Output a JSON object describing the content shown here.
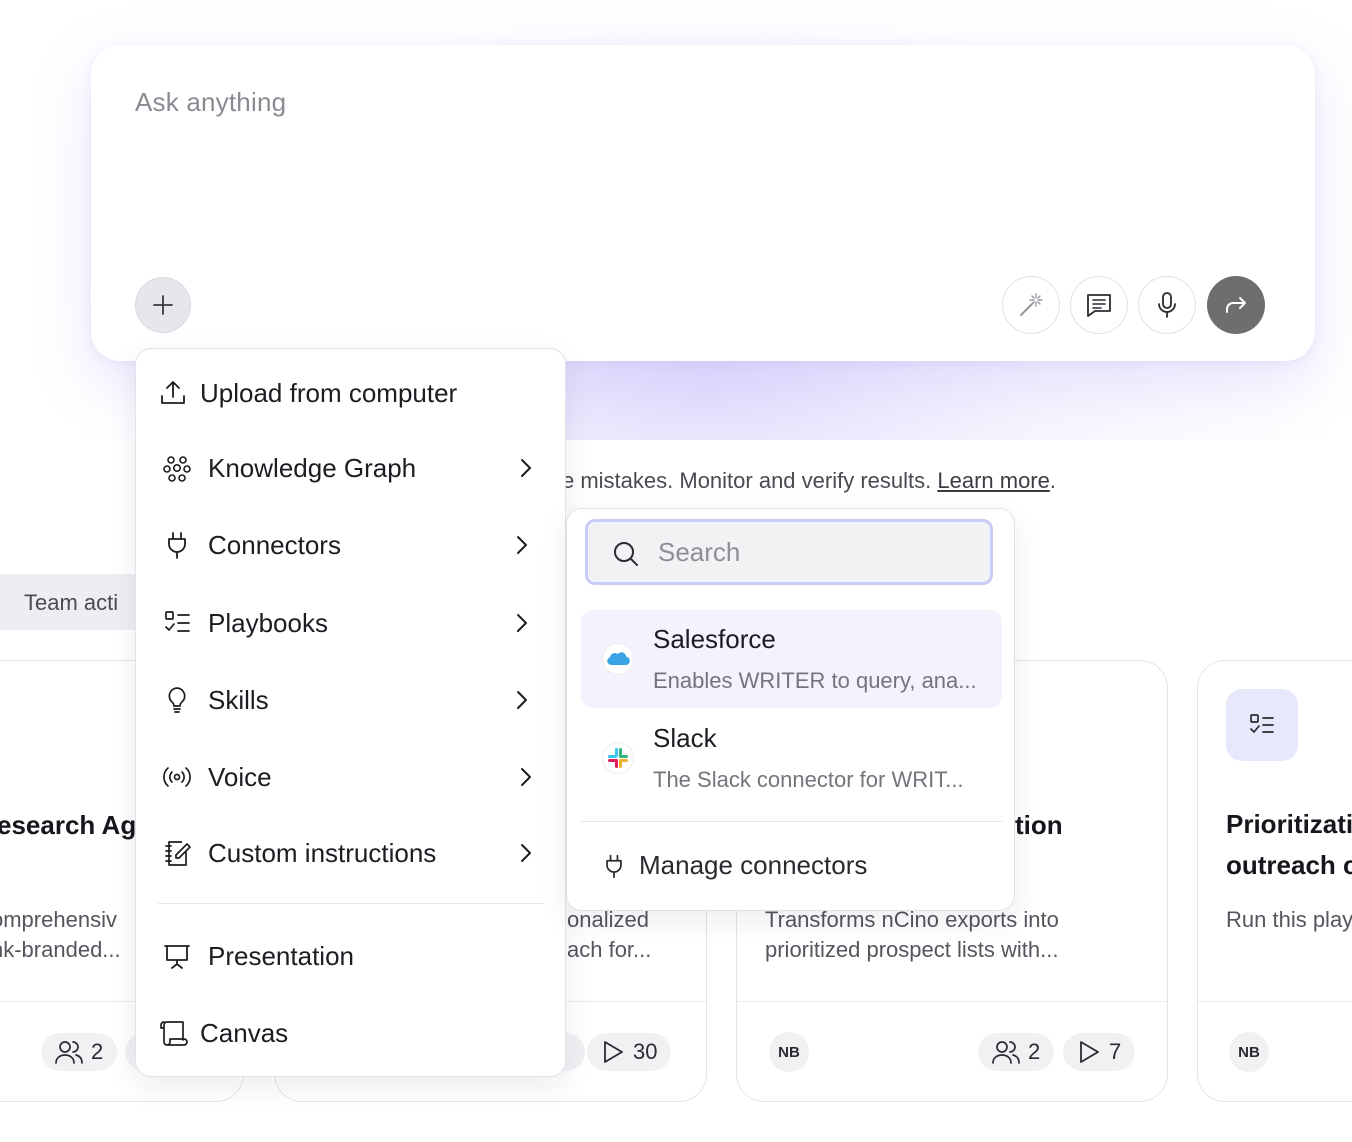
{
  "composer": {
    "placeholder": "Ask anything",
    "add_icon": "plus-icon",
    "tools": [
      {
        "name": "magic-wand-icon"
      },
      {
        "name": "message-square-icon"
      },
      {
        "name": "microphone-icon"
      }
    ],
    "send_icon": "forward-arrow-icon"
  },
  "disclaimer": {
    "text": "e mistakes. Monitor and verify results. ",
    "link": "Learn more",
    "suffix": "."
  },
  "tabs": {
    "team_label": "Team acti"
  },
  "menu": {
    "items": [
      {
        "label": "Upload from computer",
        "icon": "upload-icon",
        "submenu": false
      },
      {
        "label": "Knowledge Graph",
        "icon": "knowledge-graph-icon",
        "submenu": true
      },
      {
        "label": "Connectors",
        "icon": "plug-icon",
        "submenu": true
      },
      {
        "label": "Playbooks",
        "icon": "checklist-icon",
        "submenu": true
      },
      {
        "label": "Skills",
        "icon": "lightbulb-icon",
        "submenu": true
      },
      {
        "label": "Voice",
        "icon": "broadcast-icon",
        "submenu": true
      },
      {
        "label": "Custom instructions",
        "icon": "notebook-edit-icon",
        "submenu": true
      },
      {
        "label": "Presentation",
        "icon": "presentation-icon",
        "submenu": false
      },
      {
        "label": "Canvas",
        "icon": "scroll-icon",
        "submenu": false
      }
    ]
  },
  "connectors": {
    "search_placeholder": "Search",
    "items": [
      {
        "name": "Salesforce",
        "description": "Enables WRITER to query, ana...",
        "logo": "salesforce-logo"
      },
      {
        "name": "Slack",
        "description": "The Slack connector for WRIT...",
        "logo": "slack-logo"
      }
    ],
    "manage_label": "Manage connectors"
  },
  "cards": [
    {
      "title": "esearch Ag",
      "desc_lines": [
        "omprehensiv",
        "nk-branded..."
      ],
      "users": "2"
    },
    {
      "title": "",
      "desc_lines": [
        "onalized",
        "ach for..."
      ],
      "runs": "30"
    },
    {
      "title": "tion",
      "desc_lines": [
        "Transforms nCino exports into",
        "prioritized prospect lists with..."
      ],
      "author": "NB",
      "users": "2",
      "runs": "7"
    },
    {
      "title_lines": [
        "Prioritizatio",
        "outreach c"
      ],
      "desc_lines": [
        "Run this play"
      ],
      "author": "NB"
    }
  ]
}
